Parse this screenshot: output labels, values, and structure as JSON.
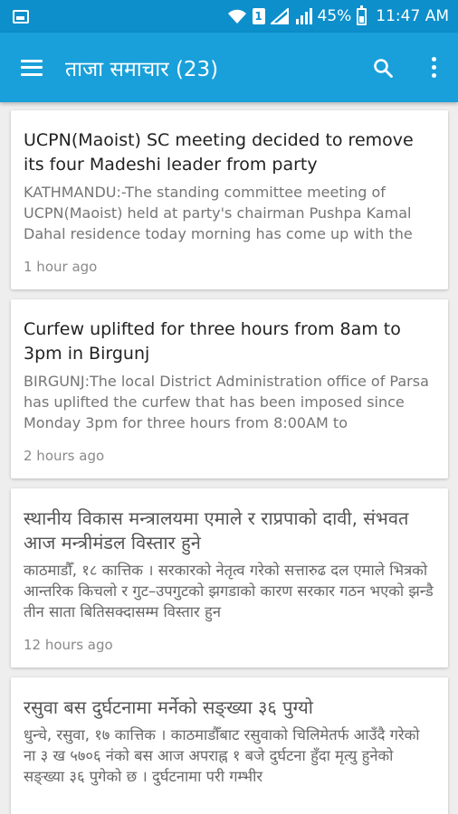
{
  "status_bar": {
    "battery": "45%",
    "time": "11:47 AM",
    "sim_label": "1"
  },
  "app_bar": {
    "title": "ताजा समाचार (23)"
  },
  "articles": [
    {
      "title": "UCPN(Maoist) SC meeting decided to remove its four Madeshi leader from party",
      "excerpt": "KATHMANDU:-The standing committee meeting of UCPN(Maoist) held at party's chairman Pushpa Kamal Dahal residence today morning has come up with the",
      "time": "1 hour ago"
    },
    {
      "title": "Curfew uplifted for three hours from 8am to 3pm in Birgunj",
      "excerpt": "BIRGUNJ:The local District Administration office of Parsa has uplifted the curfew that has been imposed since Monday 3pm for three hours from 8:00AM to",
      "time": "2 hours ago"
    },
    {
      "title": "स्थानीय विकास मन्त्रालयमा एमाले र राप्रपाको दावी, संभवत आज मन्त्रीमंडल विस्तार हुने",
      "excerpt": "काठमाडौँ, १८ कात्तिक । सरकारको नेतृत्व गरेको सत्तारुढ दल एमाले भित्रको आन्तरिक किचलो र गुट–उपगुटको झगडाको कारण सरकार गठन भएको झन्डै तीन साता बितिसक्दासम्म विस्तार हुन",
      "time": "12 hours ago"
    },
    {
      "title": "रसुवा बस दुर्घटनामा मर्नेको सङ्ख्या ३६ पुग्यो",
      "excerpt": "धुन्चे, रसुवा, १७ कात्तिक । काठमाडौँबाट रसुवाको चिलिमेतर्फ आउँदै गरेको ना ३ ख ५७०६ नंको बस आज अपराह्न १ बजे दुर्घटना हुँदा मृत्यु हुनेको सङ्ख्या ३६ पुगेको छ । दुर्घटनामा परी गम्भीर",
      "time": ""
    }
  ],
  "colors": {
    "status_bar": "#0d8fcb",
    "app_bar": "#19a0da",
    "background": "#eeeeee"
  },
  "icons": {
    "menu": "hamburger-icon",
    "search": "search-icon",
    "overflow": "more-vert-icon"
  }
}
